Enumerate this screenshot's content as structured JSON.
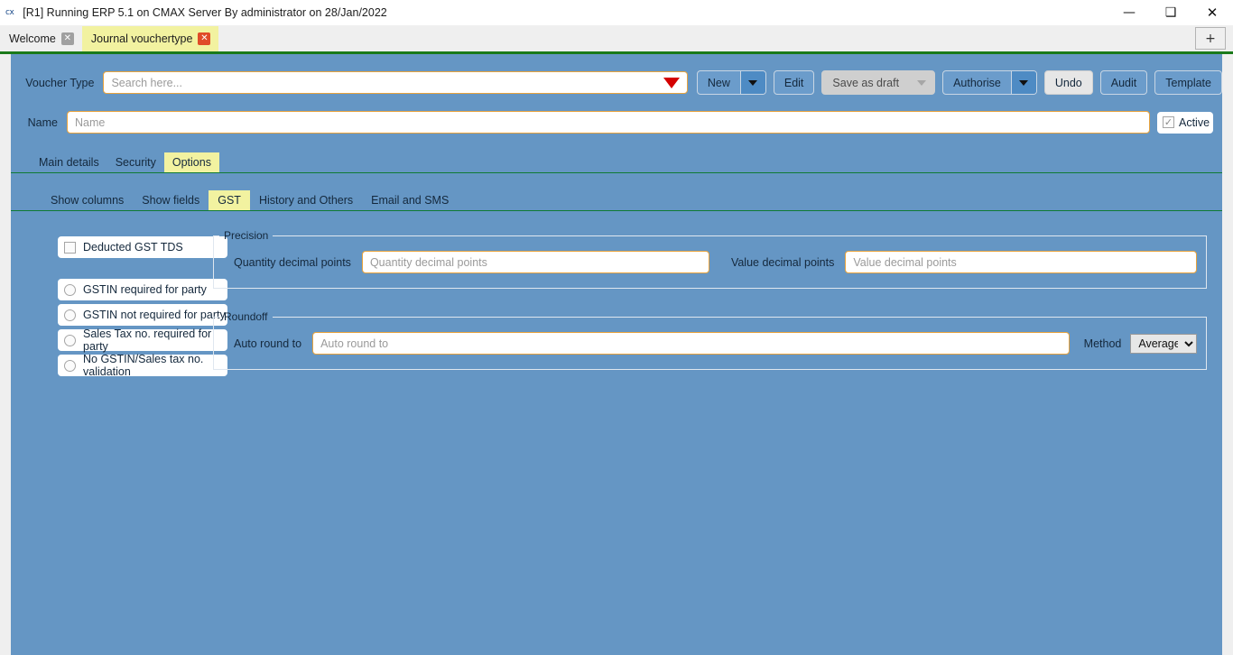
{
  "window": {
    "app_glyph": "cx",
    "title": "[R1] Running ERP 5.1 on CMAX Server By administrator on 28/Jan/2022",
    "minimize": "—",
    "restore": "❑",
    "close": "✕"
  },
  "tabstrip": {
    "tabs": [
      {
        "label": "Welcome",
        "close": "✕",
        "active": false
      },
      {
        "label": "Journal vouchertype",
        "close": "✕",
        "active": true
      }
    ],
    "new_tab": "+"
  },
  "voucher_row": {
    "label": "Voucher Type",
    "search_placeholder": "Search here...",
    "search_value": "",
    "dropdown_icon": "red-caret-down-icon"
  },
  "toolbar": {
    "buttons": [
      {
        "label": "New",
        "split": true,
        "state": "enabled"
      },
      {
        "label": "Edit",
        "split": false,
        "state": "enabled"
      },
      {
        "label": "Save as draft",
        "split": true,
        "state": "disabled"
      },
      {
        "label": "Authorise",
        "split": true,
        "state": "enabled"
      },
      {
        "label": "Undo",
        "split": false,
        "state": "light"
      },
      {
        "label": "Audit",
        "split": false,
        "state": "enabled"
      },
      {
        "label": "Template",
        "split": false,
        "state": "enabled"
      }
    ]
  },
  "name_row": {
    "label": "Name",
    "placeholder": "Name",
    "value": "",
    "active_label": "Active",
    "active_checked": true,
    "active_mark": "✓"
  },
  "primary_tabs": [
    {
      "label": "Main details",
      "active": false
    },
    {
      "label": "Security",
      "active": false
    },
    {
      "label": "Options",
      "active": true
    }
  ],
  "secondary_tabs": [
    {
      "label": "Show columns",
      "active": false
    },
    {
      "label": "Show fields",
      "active": false
    },
    {
      "label": "GST",
      "active": true
    },
    {
      "label": "History and Others",
      "active": false
    },
    {
      "label": "Email and SMS",
      "active": false
    }
  ],
  "options": {
    "checkbox": {
      "label": "Deducted GST TDS",
      "checked": false
    },
    "radios": [
      {
        "label": "GSTIN required for party",
        "checked": false
      },
      {
        "label": "GSTIN not required for party",
        "checked": false
      },
      {
        "label": "Sales Tax no. required for party",
        "checked": false
      },
      {
        "label": "No GSTIN/Sales tax no. validation",
        "checked": false
      }
    ]
  },
  "precision": {
    "legend": "Precision",
    "quantity_label": "Quantity decimal points",
    "quantity_placeholder": "Quantity decimal points",
    "quantity_value": "",
    "value_label": "Value decimal points",
    "value_placeholder": "Value decimal points",
    "value_value": ""
  },
  "roundoff": {
    "legend": "Roundoff",
    "auto_round_label": "Auto round to",
    "auto_round_placeholder": "Auto round to",
    "auto_round_value": "",
    "method_label": "Method",
    "method_selected": "Average",
    "method_options": [
      "Average"
    ]
  },
  "colors": {
    "panel_blue": "#6596c4",
    "tab_highlight": "#f2f2a0",
    "accent_orange": "#e8a33d",
    "separator_green": "#0f7a33",
    "caret_red": "#d40000",
    "close_red": "#e04b28"
  }
}
